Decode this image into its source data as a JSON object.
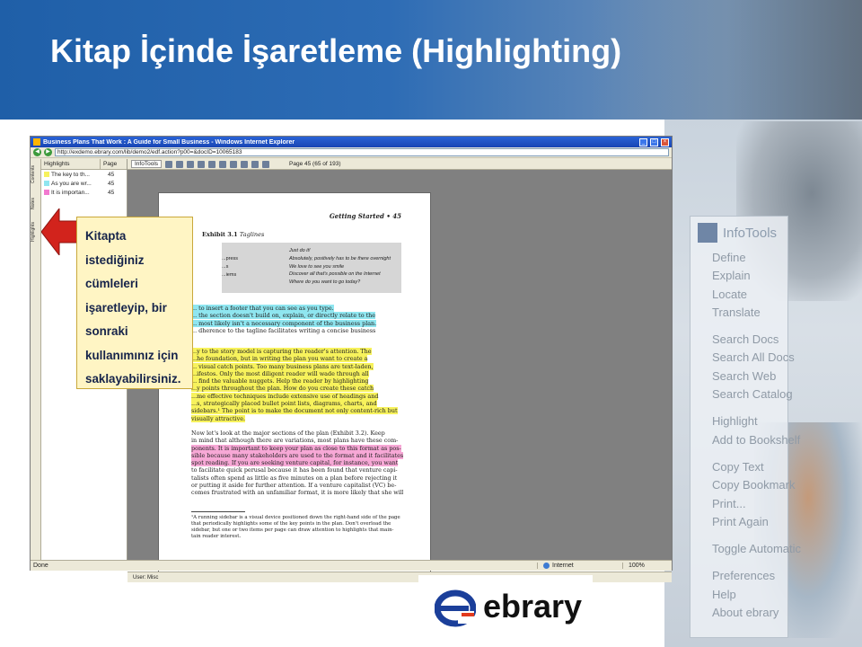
{
  "slide": {
    "title": "Kitap İçinde İşaretleme (Highlighting)"
  },
  "callout": {
    "lines": [
      "Kitapta",
      "istediğiniz",
      "cümleleri",
      "işaretleyip, bir",
      "sonraki",
      "kullanımınız için",
      "saklayabilirsiniz."
    ]
  },
  "browser": {
    "window_title": "Business Plans That Work : A Guide for Small Business - Windows Internet Explorer",
    "url": "http://exdemo.ebrary.com/lib/demo2/edf.action?p00=&docID=10065183",
    "status": "Done",
    "zone": "Internet",
    "zoom": "100%"
  },
  "highlights_panel": {
    "headers": [
      "Highlights",
      "Page"
    ],
    "rows": [
      {
        "text": "The key to th...",
        "page": "45",
        "color": "#f7f25c"
      },
      {
        "text": "As you are wr...",
        "page": "45",
        "color": "#8fe6f0"
      },
      {
        "text": "It is importan...",
        "page": "45",
        "color": "#f27ad0"
      }
    ],
    "side_tabs": [
      "Contents",
      "Notes",
      "Highlights"
    ]
  },
  "reader": {
    "toolbar_brand": "InfoTools",
    "page_indicator": "Page 45 (65 of 193)",
    "user": "User: Misc",
    "running_head": "Getting Started",
    "page_number": "45",
    "exhibit_label": "Exhibit 3.1",
    "exhibit_title": "Taglines",
    "exhibit_left": [
      "...press",
      "...s",
      "...iems"
    ],
    "exhibit_lines": [
      "Just do it!",
      "Absolutely, positively has to be there overnight",
      "We love to see you smile",
      "Discover all that's possible on the Internet",
      "Where do you want to go today?"
    ],
    "para1": [
      {
        "t": "... to insert a footer that you can see as you type.",
        "h": "cyan"
      },
      {
        "t": "... the section doesn't build on, explain, or directly relate to the",
        "h": "cyan"
      },
      {
        "t": "... most likely isn't a necessary component of the business plan.",
        "h": "cyan"
      },
      {
        "t": "... dherence to the tagline facilitates writing a concise business",
        "h": ""
      }
    ],
    "para2": [
      {
        "t": "...y to the story model is capturing the reader's attention. The",
        "h": "yellow"
      },
      {
        "t": "...he foundation, but in writing the plan you want to create a",
        "h": "yellow"
      },
      {
        "t": "... visual catch points. Too many business plans are text-laden,",
        "h": "yellow"
      },
      {
        "t": "...ifestos. Only the most diligent reader will wade through all",
        "h": "yellow"
      },
      {
        "t": "... find the valuable nuggets. Help the reader by highlighting",
        "h": "yellow"
      },
      {
        "t": "...y points throughout the plan. How do you create these catch",
        "h": "yellow"
      },
      {
        "t": "...me effective techniques include extensive use of headings and",
        "h": "yellow"
      },
      {
        "t": "...s, strategically placed bullet point lists, diagrams, charts, and",
        "h": "yellow"
      },
      {
        "t": "sidebars.¹ The point is to make the document not only content-rich but",
        "h": "yellow"
      },
      {
        "t": "visually attractive.",
        "h": "yellow"
      }
    ],
    "para3": [
      {
        "t": "Now let's look at the major sections of the plan (Exhibit 3.2). Keep",
        "h": ""
      },
      {
        "t": "in mind that although there are variations, most plans have these com-",
        "h": ""
      },
      {
        "t": "ponents. It is important to keep your plan as close to this format as pos-",
        "h": "pink"
      },
      {
        "t": "sible because many stakeholders are used to the format and it facilitates",
        "h": "pink"
      },
      {
        "t": "spot reading. If you are seeking venture capital, for instance, you want",
        "h": "pink"
      },
      {
        "t": "to facilitate quick perusal because it has been found that venture capi-",
        "h": ""
      },
      {
        "t": "talists often spend as little as five minutes on a plan before rejecting it",
        "h": ""
      },
      {
        "t": "or putting it aside for further attention. If a venture capitalist (VC) be-",
        "h": ""
      },
      {
        "t": "comes frustrated with an unfamiliar format, it is more likely that she will",
        "h": ""
      }
    ],
    "footnote": [
      "¹A running sidebar is a visual device positioned down the right-hand side of the page",
      "that periodically highlights some of the key points in the plan. Don't overload the",
      "sidebar, but one or two items per page can draw attention to highlights that main-",
      "tain reader interest."
    ]
  },
  "infotools_panel": {
    "title": "InfoTools",
    "groups": [
      [
        "Define",
        "Explain",
        "Locate",
        "Translate"
      ],
      [
        "Search Docs",
        "Search All Docs",
        "Search Web",
        "Search Catalog"
      ],
      [
        "Highlight",
        "Add to Bookshelf"
      ],
      [
        "Copy Text",
        "Copy Bookmark",
        "Print...",
        "Print Again"
      ],
      [
        "Toggle Automatic"
      ],
      [
        "Preferences",
        "Help",
        "About ebrary"
      ]
    ]
  },
  "logo": {
    "text": "ebrary",
    "colors": {
      "mark": "#1b3f9a",
      "accent": "#e23a1e"
    }
  },
  "colors": {
    "header": "#2d6cb5",
    "callout_bg": "#fff5c4",
    "callout_text": "#15234a",
    "highlight_yellow": "#f7f25c",
    "highlight_cyan": "#8fe6f0",
    "highlight_pink": "#f7a8d6"
  }
}
